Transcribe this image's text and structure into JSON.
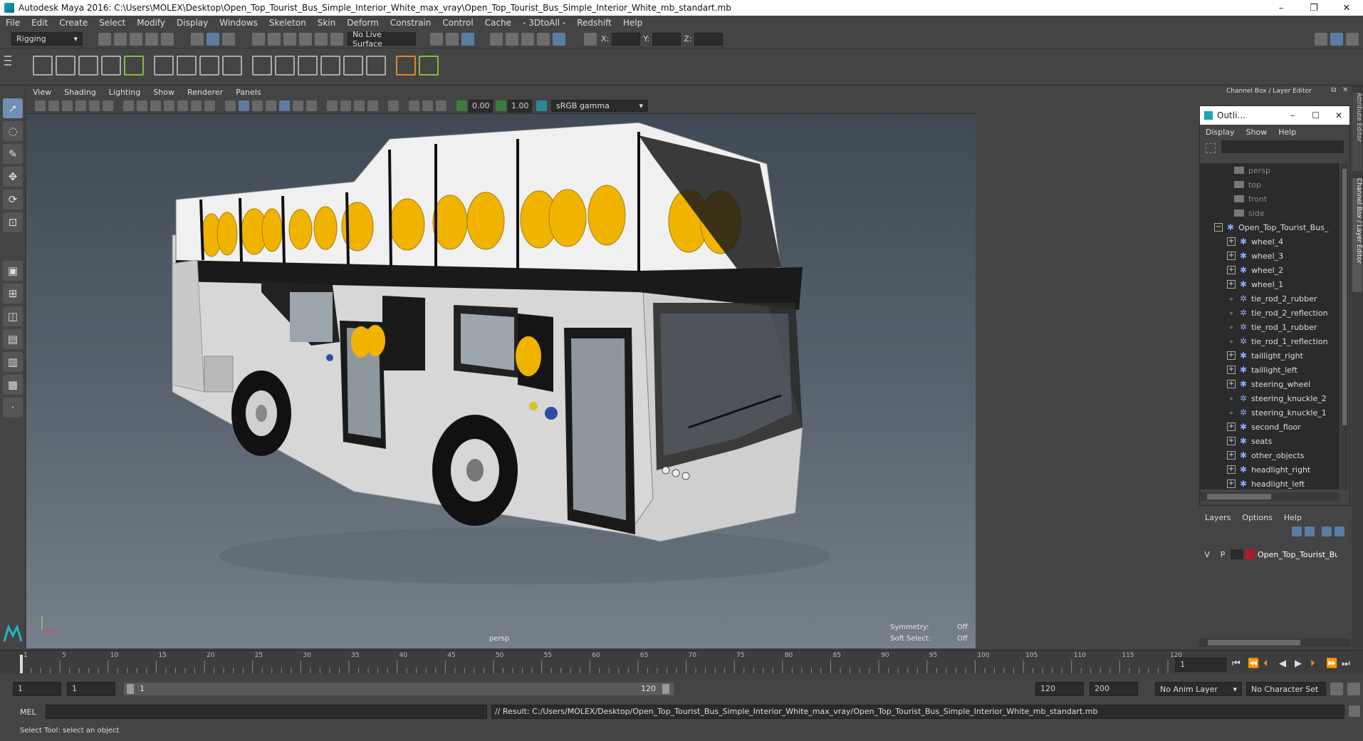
{
  "window": {
    "title": "Autodesk Maya 2016: C:\\Users\\MOLEX\\Desktop\\Open_Top_Tourist_Bus_Simple_Interior_White_max_vray\\Open_Top_Tourist_Bus_Simple_Interior_White_mb_standart.mb",
    "minimize": "–",
    "restore": "❐",
    "close": "✕"
  },
  "menus": [
    "File",
    "Edit",
    "Create",
    "Select",
    "Modify",
    "Display",
    "Windows",
    "Skeleton",
    "Skin",
    "Deform",
    "Constrain",
    "Control",
    "Cache",
    "- 3DtoAll -",
    "Redshift",
    "Help"
  ],
  "statusline": {
    "mode": "Rigging",
    "live_surface": "No Live Surface",
    "x_label": "X:",
    "y_label": "Y:",
    "z_label": "Z:"
  },
  "viewport": {
    "menus": [
      "View",
      "Shading",
      "Lighting",
      "Show",
      "Renderer",
      "Panels"
    ],
    "exposure": "0.00",
    "gamma": "1.00",
    "color_space": "sRGB gamma",
    "camera_label": "persp",
    "symmetry_label": "Symmetry:",
    "symmetry_value": "Off",
    "soft_select_label": "Soft Select:",
    "soft_select_value": "Off"
  },
  "channelbox": {
    "title": "Channel Box / Layer Editor",
    "side_tab_1": "Attribute Editor",
    "side_tab_2": "Channel Box / Layer Editor"
  },
  "outliner": {
    "title": "Outli...",
    "menus": [
      "Display",
      "Show",
      "Help"
    ],
    "cameras": [
      "persp",
      "top",
      "front",
      "side"
    ],
    "root": "Open_Top_Tourist_Bus_",
    "children": [
      {
        "label": "wheel_4",
        "expandable": true
      },
      {
        "label": "wheel_3",
        "expandable": true
      },
      {
        "label": "wheel_2",
        "expandable": true
      },
      {
        "label": "wheel_1",
        "expandable": true
      },
      {
        "label": "tie_rod_2_rubber",
        "expandable": false
      },
      {
        "label": "tie_rod_2_reflection",
        "expandable": false
      },
      {
        "label": "tie_rod_1_rubber",
        "expandable": false
      },
      {
        "label": "tie_rod_1_reflection",
        "expandable": false
      },
      {
        "label": "taillight_right",
        "expandable": true
      },
      {
        "label": "taillight_left",
        "expandable": true
      },
      {
        "label": "steering_wheel",
        "expandable": true
      },
      {
        "label": "steering_knuckle_2",
        "expandable": false
      },
      {
        "label": "steering_knuckle_1",
        "expandable": false
      },
      {
        "label": "second_floor",
        "expandable": true
      },
      {
        "label": "seats",
        "expandable": true
      },
      {
        "label": "other_objects",
        "expandable": true
      },
      {
        "label": "headlight_right",
        "expandable": true
      },
      {
        "label": "headlight_left",
        "expandable": true
      }
    ]
  },
  "layers": {
    "menus": [
      "Layers",
      "Options",
      "Help"
    ],
    "layer": {
      "v": "V",
      "p": "P",
      "name": "Open_Top_Tourist_Bus",
      "color": "#b0182b"
    }
  },
  "timeline": {
    "ticks": [
      "1",
      "5",
      "10",
      "15",
      "20",
      "25",
      "30",
      "35",
      "40",
      "45",
      "50",
      "55",
      "60",
      "65",
      "70",
      "75",
      "80",
      "85",
      "90",
      "95",
      "100",
      "105",
      "110",
      "115",
      "120"
    ],
    "current_frame": "1"
  },
  "range": {
    "start": "1",
    "playback_start": "1",
    "slider_start": "1",
    "slider_end": "120",
    "playback_end": "120",
    "end": "200",
    "anim_layer": "No Anim Layer",
    "character_set": "No Character Set"
  },
  "command": {
    "lang": "MEL",
    "result": "// Result: C:/Users/MOLEX/Desktop/Open_Top_Tourist_Bus_Simple_Interior_White_max_vray/Open_Top_Tourist_Bus_Simple_Interior_White_mb_standart.mb"
  },
  "help": "Select Tool: select an object",
  "colors": {
    "seat": "#f0b400",
    "bus_body": "#d7d7d7",
    "accent": "#5b7da3"
  }
}
